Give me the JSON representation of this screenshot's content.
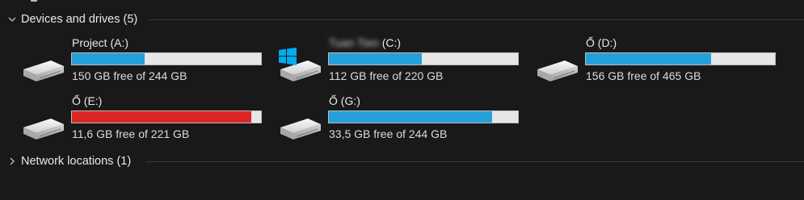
{
  "groups": {
    "devices": {
      "label": "Devices and drives (5)",
      "expanded": true,
      "chevron_icon": "chevron-down-icon"
    },
    "network": {
      "label": "Network locations (1)",
      "expanded": false,
      "chevron_icon": "chevron-right-icon"
    }
  },
  "drives": [
    {
      "id": "a",
      "name": "Project (A:)",
      "free_text": "150 GB free of 244 GB",
      "used_fraction": 0.385,
      "low_space": false,
      "icon": "hard-drive-icon"
    },
    {
      "id": "c",
      "name_blurred": "Tuan Tien",
      "name": "(C:)",
      "free_text": "112 GB free of 220 GB",
      "used_fraction": 0.491,
      "low_space": false,
      "icon": "system-drive-icon",
      "overlay_icon": "windows-logo-icon"
    },
    {
      "id": "d",
      "name": "Ổ (D:)",
      "free_text": "156 GB free of 465 GB",
      "used_fraction": 0.664,
      "low_space": false,
      "icon": "hard-drive-icon"
    },
    {
      "id": "e",
      "name": "Ổ (E:)",
      "free_text": "11,6 GB free of 221 GB",
      "used_fraction": 0.948,
      "low_space": true,
      "icon": "hard-drive-icon"
    },
    {
      "id": "g",
      "name": "Ổ (G:)",
      "free_text": "33,5 GB free of 244 GB",
      "used_fraction": 0.863,
      "low_space": false,
      "icon": "hard-drive-icon"
    }
  ],
  "colors": {
    "background": "#191919",
    "bar_fill": "#26a0da",
    "bar_fill_low": "#da2626",
    "bar_track": "#e6e6e6",
    "windows_blue": "#00adef"
  }
}
